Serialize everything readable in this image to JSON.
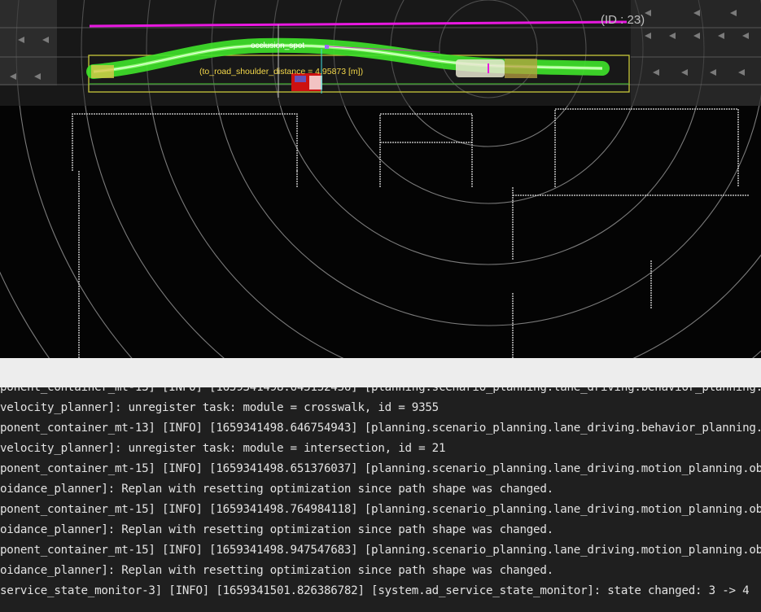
{
  "viewport": {
    "object_id_label": "(ID : 23)",
    "occlusion_label": "occlusion_spot",
    "shoulder_label": "(to_road_shoulder_distance = 4.95873 [m])"
  },
  "terminal": {
    "lines": [
      "ponent_container_mt-13] [INFO] [1659341498.645152456] [planning.scenario_planning.lane_driving.behavior_planning.beha",
      "velocity_planner]: unregister task: module = crosswalk, id = 9355",
      "ponent_container_mt-13] [INFO] [1659341498.646754943] [planning.scenario_planning.lane_driving.behavior_planning.beha",
      "velocity_planner]: unregister task: module = intersection, id = 21",
      "ponent_container_mt-15] [INFO] [1659341498.651376037] [planning.scenario_planning.lane_driving.motion_planning.obstac",
      "oidance_planner]: Replan with resetting optimization since path shape was changed.",
      "ponent_container_mt-15] [INFO] [1659341498.764984118] [planning.scenario_planning.lane_driving.motion_planning.obstac",
      "oidance_planner]: Replan with resetting optimization since path shape was changed.",
      "ponent_container_mt-15] [INFO] [1659341498.947547683] [planning.scenario_planning.lane_driving.motion_planning.obstac",
      "oidance_planner]: Replan with resetting optimization since path shape was changed.",
      "service_state_monitor-3] [INFO] [1659341501.826386782] [system.ad_service_state_monitor]: state changed: 3 -> 4"
    ]
  },
  "colors": {
    "viz_background": "#040404",
    "path_green": "#3fe02a",
    "magenta_line": "#e818e0",
    "obstacle_red": "#cc1111",
    "separator": "#ededed",
    "terminal_background": "#1f1f1f",
    "terminal_text": "#e2e2e2"
  }
}
